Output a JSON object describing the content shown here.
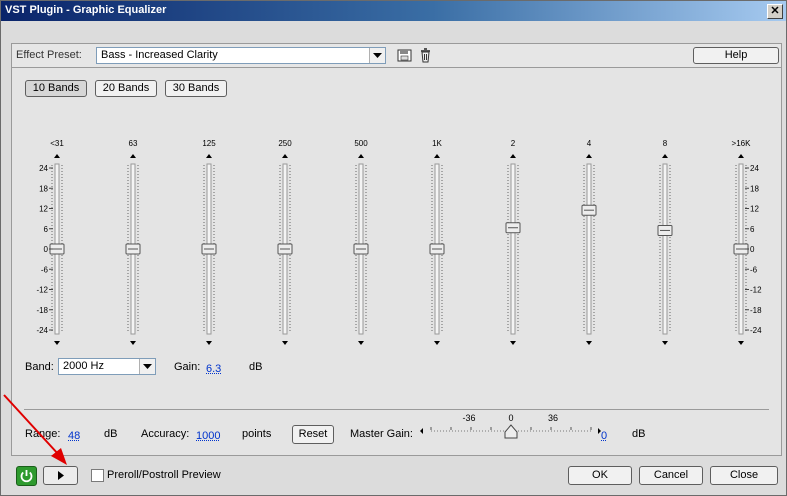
{
  "window": {
    "title": "VST Plugin - Graphic Equalizer",
    "close_label": "✕"
  },
  "preset": {
    "label": "Effect Preset:",
    "value": "Bass - Increased Clarity",
    "help_label": "Help"
  },
  "band_buttons": [
    "10 Bands",
    "20 Bands",
    "30 Bands"
  ],
  "eq": {
    "bands": [
      {
        "freq": "<31",
        "gain_db": 0
      },
      {
        "freq": "63",
        "gain_db": 0
      },
      {
        "freq": "125",
        "gain_db": 0
      },
      {
        "freq": "250",
        "gain_db": 0
      },
      {
        "freq": "500",
        "gain_db": 0
      },
      {
        "freq": "1K",
        "gain_db": 0
      },
      {
        "freq": "2",
        "gain_db": 6.3
      },
      {
        "freq": "4",
        "gain_db": 11.5
      },
      {
        "freq": "8",
        "gain_db": 5.5
      },
      {
        "freq": ">16K",
        "gain_db": 0
      }
    ],
    "scale_left": [
      "24",
      "18",
      "12",
      "6",
      "0",
      "-6",
      "-12",
      "-18",
      "-24"
    ],
    "scale_right": [
      "24",
      "18",
      "12",
      "6",
      "0",
      "-6",
      "-12",
      "-18",
      "-24"
    ],
    "gain_range_db": [
      -24,
      24
    ]
  },
  "band_select": {
    "label": "Band:",
    "value": "2000 Hz",
    "gain_label": "Gain:",
    "gain_value": "6.3",
    "gain_unit": "dB"
  },
  "range": {
    "label": "Range:",
    "value": "48",
    "unit": "dB"
  },
  "accuracy": {
    "label": "Accuracy:",
    "value": "1000",
    "unit": "points"
  },
  "reset_label": "Reset",
  "master_gain": {
    "label": "Master Gain:",
    "ticks": [
      "-36",
      "0",
      "36"
    ],
    "value": "0",
    "unit": "dB",
    "level_db": 0,
    "range_db": [
      -48,
      48
    ]
  },
  "footer": {
    "preroll_label": "Preroll/Postroll Preview",
    "ok": "OK",
    "cancel": "Cancel",
    "close": "Close"
  },
  "colors": {
    "title_bar": "#0a246a",
    "power_on": "#2e9a2e",
    "annotation_arrow": "#e00000",
    "link_value": "#0033cc"
  }
}
